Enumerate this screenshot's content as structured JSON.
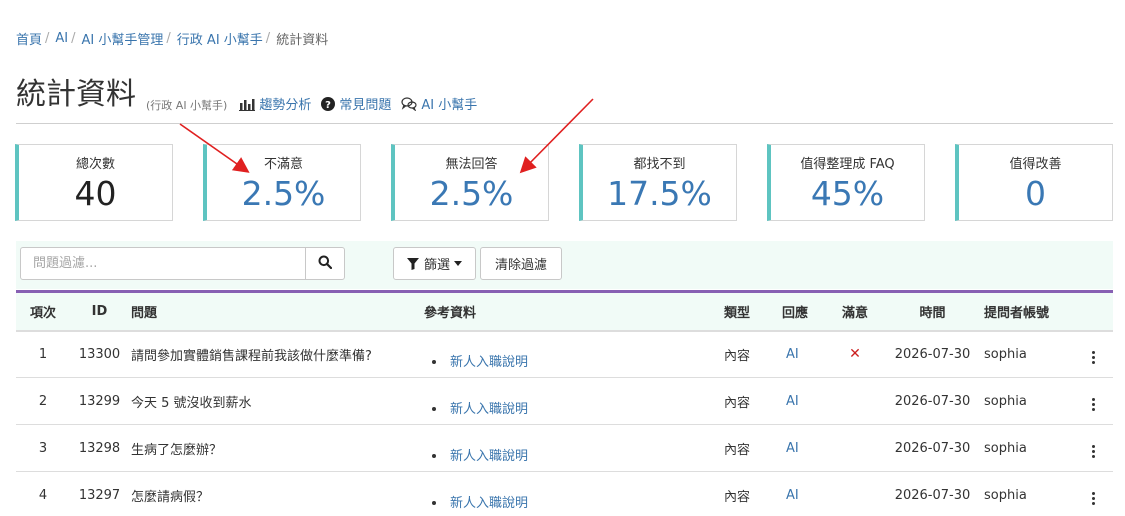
{
  "breadcrumb": [
    "首頁",
    "AI",
    "AI 小幫手管理",
    "行政 AI 小幫手",
    "統計資料"
  ],
  "header": {
    "title": "統計資料",
    "subtitle": "(行政 AI 小幫手)",
    "links": [
      {
        "label": "趨勢分析",
        "icon": "bar-chart-icon"
      },
      {
        "label": "常見問題",
        "icon": "question-circle-icon"
      },
      {
        "label": "AI 小幫手",
        "icon": "chat-bubbles-icon"
      }
    ]
  },
  "stats": [
    {
      "label": "總次數",
      "value": "40"
    },
    {
      "label": "不滿意",
      "value": "2.5%"
    },
    {
      "label": "無法回答",
      "value": "2.5%"
    },
    {
      "label": "都找不到",
      "value": "17.5%"
    },
    {
      "label": "值得整理成 FAQ",
      "value": "45%"
    },
    {
      "label": "值得改善",
      "value": "0"
    }
  ],
  "filter": {
    "search_placeholder": "問題過濾...",
    "filter_label": "篩選",
    "clear_label": "清除過濾"
  },
  "table": {
    "headers": [
      "項次",
      "ID",
      "問題",
      "參考資料",
      "類型",
      "回應",
      "滿意",
      "時間",
      "提問者帳號"
    ],
    "rows": [
      {
        "index": "1",
        "id": "13300",
        "question": "請問參加實體銷售課程前我該做什麼準備?",
        "ref": "新人入職說明",
        "type": "內容",
        "response": "AI",
        "satisfied": "✕",
        "time": "2026-07-30",
        "user": "sophia"
      },
      {
        "index": "2",
        "id": "13299",
        "question": "今天 5 號沒收到薪水",
        "ref": "新人入職說明",
        "type": "內容",
        "response": "AI",
        "satisfied": "",
        "time": "2026-07-30",
        "user": "sophia"
      },
      {
        "index": "3",
        "id": "13298",
        "question": "生病了怎麼辦？",
        "ref": "新人入職說明",
        "type": "內容",
        "response": "AI",
        "satisfied": "",
        "time": "2026-07-30",
        "user": "sophia"
      },
      {
        "index": "4",
        "id": "13297",
        "question": "怎麼請病假？",
        "ref": "新人入職說明",
        "type": "內容",
        "response": "AI",
        "satisfied": "",
        "time": "2026-07-30",
        "user": "sophia"
      }
    ]
  },
  "colors": {
    "accent_teal": "#5ec4c1",
    "link_blue": "#3a75ad",
    "table_top_border": "#8760b3",
    "annotation_red": "#e02020"
  }
}
